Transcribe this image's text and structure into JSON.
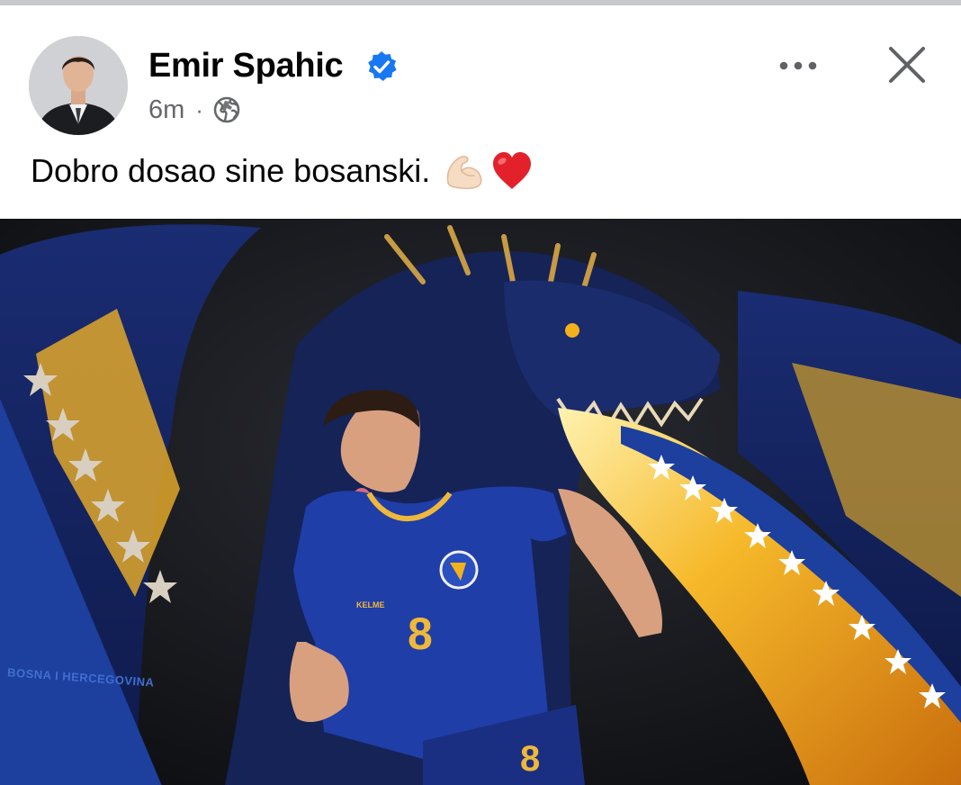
{
  "post": {
    "author_name": "Emir Spahic",
    "timestamp": "6m",
    "separator": "·",
    "visibility_icon": "globe-icon",
    "verified_icon": "verified-badge-icon",
    "text": "Dobro dosao sine bosanski.",
    "emojis": [
      "flexed-biceps-emoji",
      "red-heart-emoji"
    ]
  },
  "image": {
    "banner_text": "BOSNA I HERCEGOVINA",
    "kit_brand": "KELME",
    "jersey_number": "8",
    "shorts_number": "8"
  },
  "colors": {
    "verified_blue": "#1877f2",
    "secondary_text": "#65676b",
    "flag_blue": "#1d3f9e",
    "flag_yellow": "#f3b21b"
  }
}
